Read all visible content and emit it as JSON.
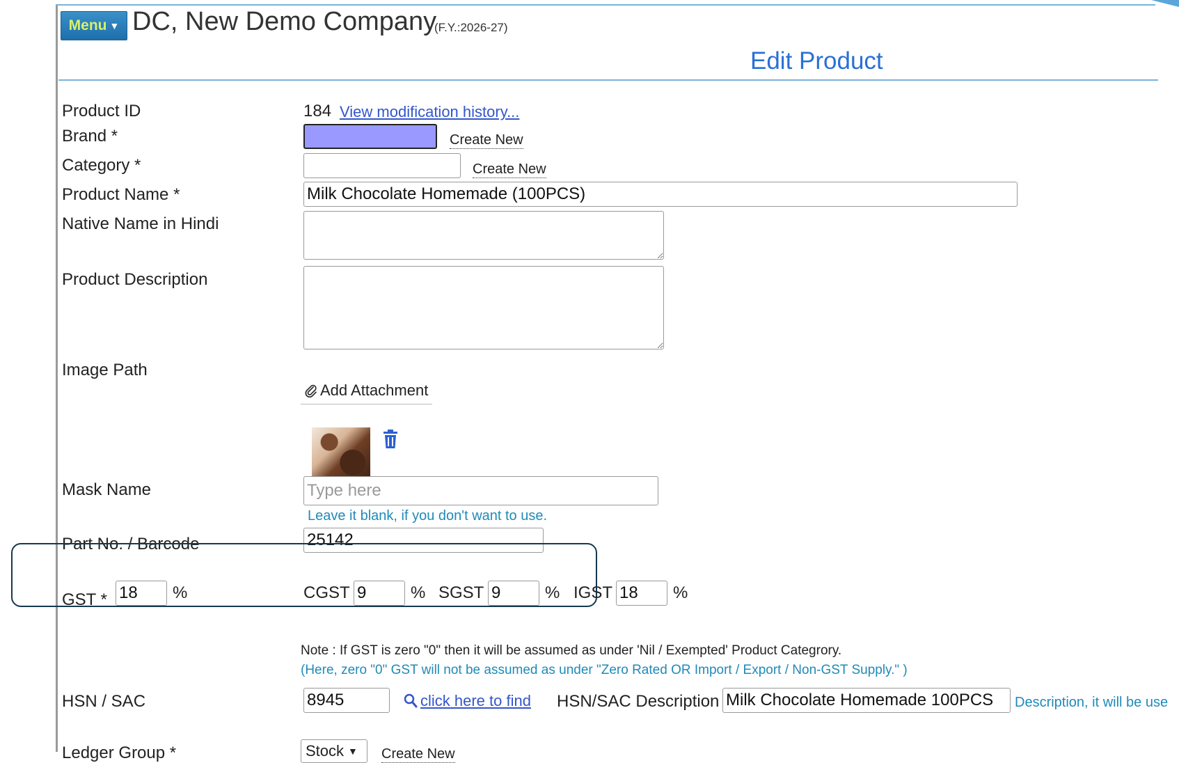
{
  "header": {
    "menu_label": "Menu",
    "company": "DC, New Demo Company",
    "fy": "(F.Y.:2026-27)",
    "page_title": "Edit Product"
  },
  "form": {
    "product_id": {
      "label": "Product ID",
      "value": "184",
      "history_link": "View modification history..."
    },
    "brand": {
      "label": "Brand *",
      "value": "",
      "create_new": "Create New"
    },
    "category": {
      "label": "Category *",
      "value": "",
      "create_new": "Create New"
    },
    "product_name": {
      "label": "Product Name *",
      "value": "Milk Chocolate Homemade (100PCS)"
    },
    "native_name": {
      "label": "Native Name in Hindi",
      "value": ""
    },
    "description": {
      "label": "Product Description",
      "value": ""
    },
    "image_path": {
      "label": "Image Path",
      "attach_label": "Add Attachment",
      "attach_icon": "paperclip-icon",
      "delete_icon": "trash-icon"
    },
    "mask_name": {
      "label": "Mask Name",
      "placeholder": "Type here",
      "hint": "Leave it blank, if you don't want to use."
    },
    "part_no": {
      "label": "Part No. / Barcode",
      "value": "25142"
    },
    "gst": {
      "label": "GST *",
      "value": "18",
      "pct": "%",
      "cgst_label": "CGST",
      "cgst_value": "9",
      "sgst_label": "SGST",
      "sgst_value": "9",
      "igst_label": "IGST",
      "igst_value": "18",
      "note": "Note : If GST is zero \"0\" then it will be assumed as under 'Nil / Exempted' Product Categrory.",
      "note_blue": "(Here, zero \"0\" GST will not be assumed as under \"Zero Rated OR Import / Export / Non-GST Supply.\" )"
    },
    "hsn": {
      "label": "HSN / SAC",
      "value": "8945",
      "find_link": "click here to find",
      "desc_label": "HSN/SAC Description",
      "desc_value": "Milk Chocolate Homemade 100PCS",
      "desc_hint": "Description, it will be use"
    },
    "ledger_group": {
      "label": "Ledger Group *",
      "value": "Stock",
      "create_new": "Create New"
    }
  },
  "colors": {
    "accent": "#2a6fd6",
    "brand_selected": "#9999ff",
    "hint": "#1f8ab8",
    "menu": "#1e6fab"
  }
}
